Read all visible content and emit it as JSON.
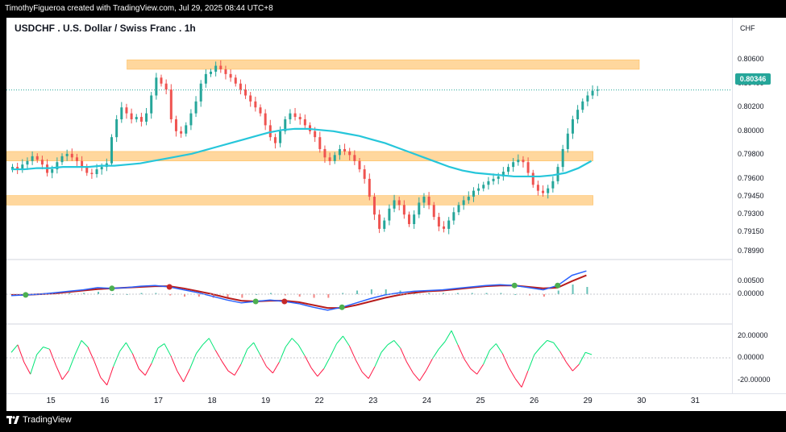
{
  "header": {
    "credit": "TimothyFigueroa created with TradingView.com, Jul 29, 2025 08:44 UTC+8"
  },
  "brand": {
    "name": "TradingView"
  },
  "chart_data": {
    "type": "candlestick",
    "title": "USDCHF . U.S. Dollar / Swiss Franc . 1h",
    "currency": "CHF",
    "last_price": "0.80346",
    "colors": {
      "up": "#26a69a",
      "down": "#ef5350",
      "ma": "#26c6da",
      "zone": "#ffb74d",
      "macd": "#2962ff",
      "signal": "#b71c1c",
      "rsi_up": "#00e676",
      "rsi_down": "#ff1744"
    },
    "price_ylim": [
      0.7899,
      0.8075
    ],
    "price_ticks": [
      "0.80600",
      "0.80400",
      "0.80200",
      "0.80000",
      "0.79800",
      "0.79600",
      "0.79450",
      "0.79300",
      "0.79150",
      "0.78990"
    ],
    "price_tick_values": [
      0.806,
      0.804,
      0.802,
      0.8,
      0.798,
      0.796,
      0.7945,
      0.793,
      0.7915,
      0.7899
    ],
    "x_ticks": [
      "15",
      "16",
      "17",
      "18",
      "19",
      "22",
      "23",
      "24",
      "25",
      "26",
      "29",
      "30",
      "31"
    ],
    "x_tick_index": [
      12,
      28,
      44,
      60,
      76,
      92,
      108,
      124,
      140,
      156,
      172,
      188,
      204
    ],
    "zones": [
      {
        "from": 0.8052,
        "to": 0.806,
        "x0": 35,
        "x1": 190
      },
      {
        "from": 0.7975,
        "to": 0.7983,
        "x0": 0,
        "x1": 176
      },
      {
        "from": 0.7938,
        "to": 0.7946,
        "x0": 0,
        "x1": 176
      }
    ],
    "closes": [
      0.797,
      0.7968,
      0.7972,
      0.7975,
      0.7979,
      0.7976,
      0.7972,
      0.7965,
      0.7968,
      0.7974,
      0.7979,
      0.7981,
      0.7978,
      0.7975,
      0.797,
      0.7965,
      0.7964,
      0.7968,
      0.797,
      0.7973,
      0.7995,
      0.801,
      0.802,
      0.8015,
      0.801,
      0.8012,
      0.8008,
      0.8015,
      0.803,
      0.8045,
      0.804,
      0.8035,
      0.801,
      0.8,
      0.7998,
      0.8005,
      0.8015,
      0.8025,
      0.804,
      0.8048,
      0.805,
      0.8055,
      0.8052,
      0.8048,
      0.8045,
      0.804,
      0.8035,
      0.803,
      0.8025,
      0.802,
      0.8015,
      0.8005,
      0.7995,
      0.799,
      0.8,
      0.801,
      0.8015,
      0.8012,
      0.801,
      0.8005,
      0.8,
      0.7995,
      0.7985,
      0.7978,
      0.7975,
      0.798,
      0.7985,
      0.7983,
      0.798,
      0.7975,
      0.7968,
      0.796,
      0.7945,
      0.793,
      0.7918,
      0.7925,
      0.7935,
      0.7942,
      0.7938,
      0.793,
      0.7922,
      0.793,
      0.794,
      0.7945,
      0.7938,
      0.7928,
      0.792,
      0.7918,
      0.7925,
      0.7932,
      0.7938,
      0.7942,
      0.7945,
      0.795,
      0.7952,
      0.7955,
      0.7958,
      0.796,
      0.7962,
      0.7966,
      0.797,
      0.7974,
      0.7976,
      0.7974,
      0.7965,
      0.7955,
      0.795,
      0.7948,
      0.7952,
      0.7958,
      0.797,
      0.7985,
      0.7998,
      0.801,
      0.8018,
      0.8025,
      0.803,
      0.8034,
      0.8035
    ],
    "ma200": [
      0.7968,
      0.7968,
      0.7969,
      0.7969,
      0.797,
      0.797,
      0.797,
      0.7971,
      0.7971,
      0.7972,
      0.7973,
      0.7975,
      0.7977,
      0.7979,
      0.7981,
      0.7984,
      0.7987,
      0.799,
      0.7993,
      0.7996,
      0.7999,
      0.8001,
      0.8002,
      0.8002,
      0.8001,
      0.8,
      0.7998,
      0.7996,
      0.7993,
      0.799,
      0.7986,
      0.7982,
      0.7978,
      0.7974,
      0.797,
      0.7967,
      0.7965,
      0.7964,
      0.7963,
      0.7962,
      0.7962,
      0.7962,
      0.7963,
      0.7965,
      0.7969,
      0.7975
    ],
    "macd": [
      -0.2,
      -0.1,
      0.0,
      0.2,
      0.4,
      0.6,
      0.9,
      0.8,
      0.9,
      1.1,
      1.2,
      1.0,
      0.6,
      0.2,
      -0.3,
      -0.8,
      -1.2,
      -1.0,
      -0.8,
      -1.0,
      -1.3,
      -1.8,
      -2.2,
      -1.8,
      -1.2,
      -0.6,
      -0.1,
      0.2,
      0.4,
      0.5,
      0.6,
      0.8,
      1.0,
      1.2,
      1.3,
      1.2,
      0.9,
      0.6,
      1.2,
      2.6,
      3.2
    ],
    "signal": [
      -0.1,
      -0.1,
      0.0,
      0.1,
      0.3,
      0.5,
      0.7,
      0.8,
      0.9,
      1.0,
      1.1,
      1.1,
      0.8,
      0.4,
      0.0,
      -0.5,
      -0.9,
      -1.0,
      -0.9,
      -0.9,
      -1.1,
      -1.5,
      -1.9,
      -1.9,
      -1.5,
      -1.0,
      -0.5,
      -0.1,
      0.2,
      0.4,
      0.5,
      0.7,
      0.9,
      1.1,
      1.2,
      1.2,
      1.0,
      0.8,
      0.9,
      1.8,
      2.6
    ],
    "macd_ticks": [
      "0.00500",
      "0.00000"
    ],
    "rsi_ticks": [
      "20.00000",
      "0.00000",
      "-20.00000"
    ],
    "rsi": [
      5,
      12,
      -4,
      -15,
      3,
      10,
      8,
      -7,
      -20,
      -12,
      3,
      16,
      10,
      -3,
      -18,
      -25,
      -8,
      6,
      14,
      4,
      -10,
      -16,
      -5,
      9,
      13,
      2,
      -12,
      -22,
      -10,
      4,
      12,
      18,
      7,
      -3,
      -12,
      -16,
      -6,
      8,
      14,
      3,
      -8,
      -14,
      -4,
      10,
      18,
      12,
      2,
      -9,
      -17,
      -10,
      1,
      13,
      20,
      11,
      -2,
      -13,
      -19,
      -8,
      5,
      12,
      16,
      9,
      -4,
      -14,
      -21,
      -12,
      -1,
      8,
      15,
      25,
      12,
      -1,
      -10,
      -15,
      -6,
      7,
      13,
      4,
      -9,
      -19,
      -27,
      -12,
      3,
      10,
      16,
      14,
      6,
      -4,
      -12,
      -6,
      5,
      3
    ]
  }
}
